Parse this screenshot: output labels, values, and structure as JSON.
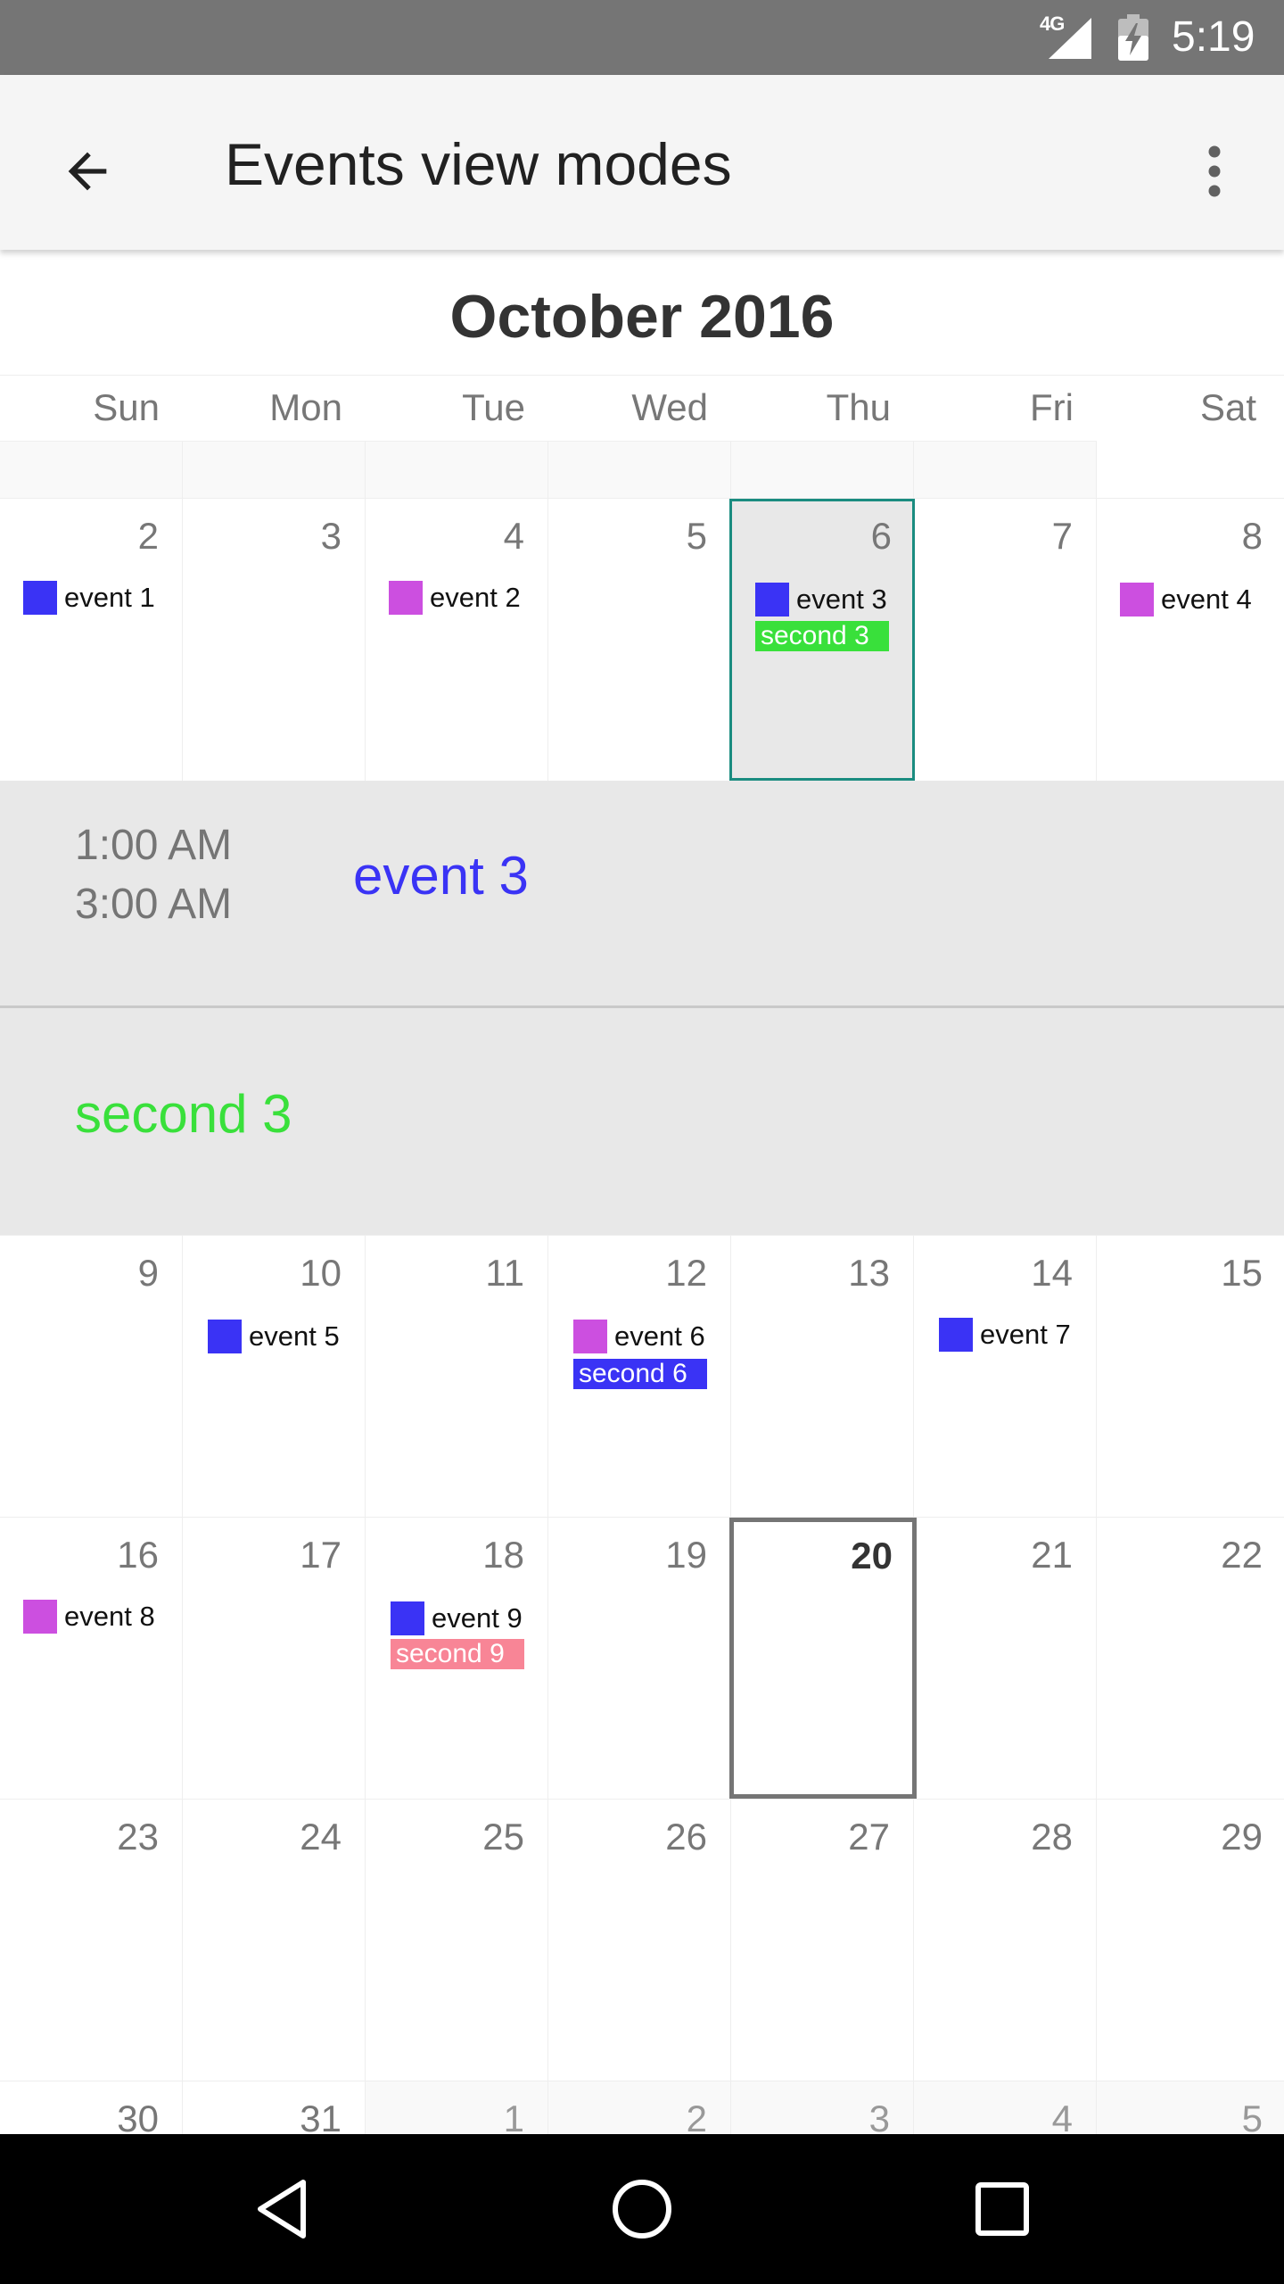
{
  "status_bar": {
    "network": "4G",
    "time": "5:19",
    "icons": [
      "signal-icon",
      "battery-charging-icon"
    ]
  },
  "app_bar": {
    "title": "Events view modes",
    "back_icon": "arrow-back-icon",
    "overflow_icon": "more-vert-icon"
  },
  "calendar": {
    "month_title": "October 2016",
    "weekdays": [
      "Sun",
      "Mon",
      "Tue",
      "Wed",
      "Thu",
      "Fri",
      "Sat"
    ],
    "week1": {
      "days": [
        "2",
        "3",
        "4",
        "5",
        "6",
        "7",
        "8"
      ],
      "events": {
        "sun": "event 1",
        "tue": "event 2",
        "thu": "event 3",
        "thu_second": "second 3",
        "sat": "event 4"
      }
    },
    "expanded": {
      "event3": {
        "start": "1:00 AM",
        "end": "3:00 AM",
        "title": "event 3"
      },
      "second3": {
        "title": "second 3"
      }
    },
    "week2": {
      "days": [
        "9",
        "10",
        "11",
        "12",
        "13",
        "14",
        "15"
      ],
      "events": {
        "mon": "event 5",
        "wed": "event 6",
        "wed_second": "second 6",
        "fri": "event 7"
      }
    },
    "week3": {
      "days": [
        "16",
        "17",
        "18",
        "19",
        "20",
        "21",
        "22"
      ],
      "events": {
        "sun": "event 8",
        "tue": "event 9",
        "tue_second": "second 9"
      }
    },
    "week4": {
      "days": [
        "23",
        "24",
        "25",
        "26",
        "27",
        "28",
        "29"
      ]
    },
    "week5": {
      "days": [
        "30",
        "31",
        "1",
        "2",
        "3",
        "4",
        "5"
      ]
    },
    "colors": {
      "blue": "#3a33f5",
      "purple": "#cc4fe0",
      "green": "#39e03b",
      "pink": "#f88596",
      "selected_border": "#1a8c80",
      "today_border": "#757575"
    }
  },
  "nav_bar": {
    "icons": [
      "back-triangle-icon",
      "home-circle-icon",
      "recents-square-icon"
    ]
  }
}
